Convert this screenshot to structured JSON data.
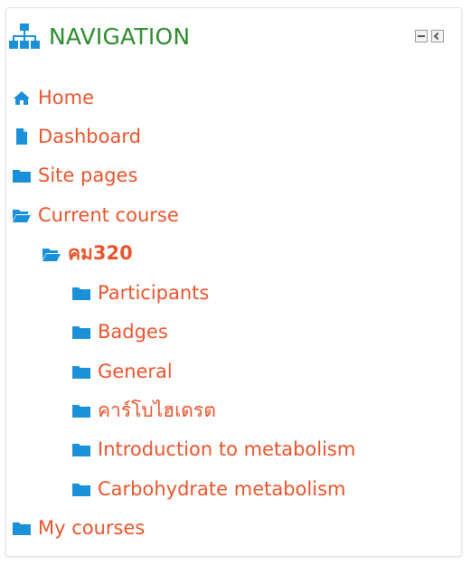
{
  "header": {
    "title": "NAVIGATION",
    "icon": "sitemap-icon",
    "controls": [
      "minimize-icon",
      "dock-icon"
    ],
    "title_color": "#2e8b2e"
  },
  "accent_color": "#e8542c",
  "icon_color": "#1a90d9",
  "nav": {
    "home": {
      "label": "Home",
      "icon": "home-icon"
    },
    "dashboard": {
      "label": "Dashboard",
      "icon": "file-icon"
    },
    "site_pages": {
      "label": "Site pages",
      "icon": "folder-icon"
    },
    "current_course": {
      "label": "Current course",
      "icon": "folder-open-icon"
    },
    "course": {
      "label": "คม320",
      "icon": "folder-open-icon"
    },
    "participants": {
      "label": "Participants",
      "icon": "folder-icon"
    },
    "badges": {
      "label": "Badges",
      "icon": "folder-icon"
    },
    "general": {
      "label": "General",
      "icon": "folder-icon"
    },
    "carbohydrate_th": {
      "label": "คาร์โบไฮเดรต",
      "icon": "folder-icon"
    },
    "intro_metabolism": {
      "label": "Introduction to metabolism",
      "icon": "folder-icon"
    },
    "carb_metabolism": {
      "label": "Carbohydrate metabolism",
      "icon": "folder-icon"
    },
    "my_courses": {
      "label": "My courses",
      "icon": "folder-icon"
    }
  }
}
